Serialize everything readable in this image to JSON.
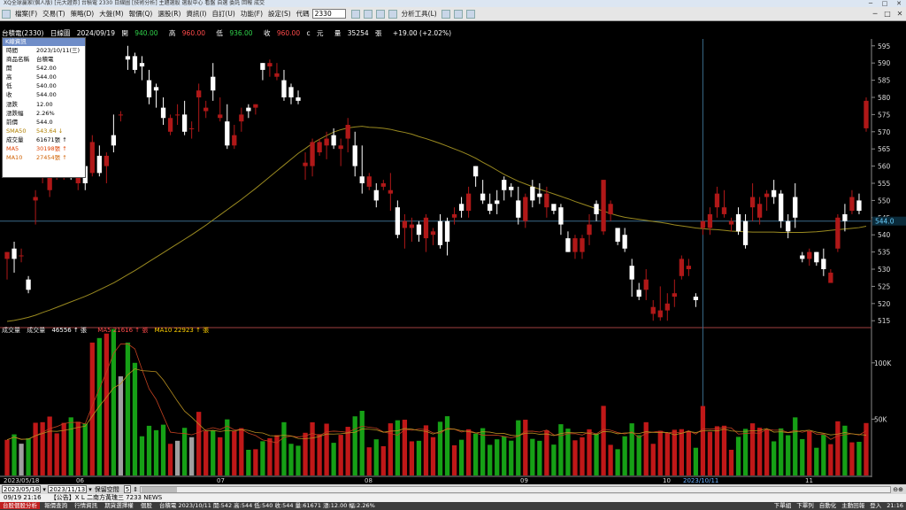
{
  "window": {
    "title": "XQ全球贏家(個人版) [元大證券] 台積電 2330 日線圖 [技術分析] 主題選股 選股中心 看盤 自選 委託 回報 成交",
    "controls": [
      "─",
      "□",
      "✕"
    ]
  },
  "menu": {
    "items": [
      "檔案(F)",
      "交易(T)",
      "策略(D)",
      "大盤(M)",
      "報價(Q)",
      "選股(R)",
      "資訊(I)",
      "自訂(U)",
      "功能(F)",
      "設定(S)",
      "代碼"
    ],
    "code_value": "2330",
    "tools_label": "分析工具(L)"
  },
  "stock": {
    "name": "台積電(2330)",
    "period": "日線圖",
    "date": "2024/09/19",
    "open_label": "開",
    "open": "940.00",
    "high_label": "高",
    "high": "960.00",
    "low_label": "低",
    "low": "936.00",
    "close_label": "收",
    "close": "960.00",
    "close_flag": "c",
    "unit": "元",
    "vol_label": "量",
    "volume": "35254",
    "vol_unit": "張",
    "change": "+19.00 (+2.02%)"
  },
  "tooltip": {
    "title": "K線資訊",
    "rows": [
      {
        "k": "時間",
        "v": "2023/10/11(三)",
        "c": "#000"
      },
      {
        "k": "商品名稱",
        "v": "台積電",
        "c": "#000"
      },
      {
        "k": "開",
        "v": "542.00",
        "c": "#000"
      },
      {
        "k": "高",
        "v": "544.00",
        "c": "#000"
      },
      {
        "k": "低",
        "v": "540.00",
        "c": "#000"
      },
      {
        "k": "收",
        "v": "544.00",
        "c": "#000"
      },
      {
        "k": "漲跌",
        "v": "12.00",
        "c": "#000"
      },
      {
        "k": "漲跌幅",
        "v": "2.26%",
        "c": "#000"
      },
      {
        "k": "前價",
        "v": "544.0",
        "c": "#000"
      },
      {
        "k": "SMA50",
        "v": "543.64 ↓",
        "c": "#b08000"
      },
      {
        "k": "成交量",
        "v": "61671張 ↑",
        "c": "#000"
      },
      {
        "k": "MA5",
        "v": "30198張 ↑",
        "c": "#e04000"
      },
      {
        "k": "MA10",
        "v": "27454張 ↑",
        "c": "#d06000"
      }
    ]
  },
  "volume_header": {
    "label": "成交量",
    "vol_name": "成交量",
    "vol": "46556 ↑ 張",
    "ma5": "MA5 21616 ↑ 張",
    "ma10": "MA10 22923 ↑ 張"
  },
  "price_axis": {
    "labels": [
      "595",
      "590",
      "585",
      "580",
      "575",
      "570",
      "565",
      "560",
      "555",
      "550",
      "545",
      "540",
      "535",
      "530",
      "525",
      "520",
      "515"
    ],
    "marker": "544.0"
  },
  "volume_axis": {
    "labels": [
      "100K",
      "50K"
    ]
  },
  "x_axis": {
    "labels": [
      "2023/05/18",
      "06",
      "07",
      "08",
      "09",
      "10",
      "2023/10/11",
      "11"
    ]
  },
  "date_range": {
    "from": "2023/05/18",
    "to": "2023/11/13",
    "keep_label": "保留空間",
    "keep_value": "5"
  },
  "status1": {
    "time": "09/19 21:16",
    "news": "【公告】X L 二南方黃瑰三 7233 NEWS"
  },
  "status2": {
    "items": [
      "台股個股分析",
      "報價查詢",
      "行情資訊",
      "期貨選擇權",
      "個股",
      "台積電 2023/10/11 開:542 高:544 低:540 收:544 量:61671 漲:12.00 幅:2.26%"
    ],
    "right": [
      "下單組",
      "下單列",
      "自動化",
      "主動回報",
      "登入",
      "21:16"
    ]
  },
  "colors": {
    "up": "#b01818",
    "down": "#ffffff",
    "up_vol": "#c01818",
    "down_vol": "#16a016",
    "flat_vol": "#a0a0a0",
    "sma50": "#9a8a20",
    "ma_vol": "#b89020",
    "accent": "#6f8dc8"
  },
  "chart_data": {
    "type": "candlestick",
    "title": "台積電(2330) 日線圖",
    "ylim": [
      513,
      597
    ],
    "vol_ylim": [
      0,
      125000
    ],
    "candles": [
      {
        "d": "05/18",
        "o": 533,
        "h": 535,
        "l": 527,
        "c": 535
      },
      {
        "d": "05/19",
        "o": 536,
        "h": 538,
        "l": 529,
        "c": 533
      },
      {
        "d": "05/22",
        "o": 534,
        "h": 536,
        "l": 532,
        "c": 534
      },
      {
        "d": "05/23",
        "o": 527,
        "h": 528,
        "l": 523,
        "c": 524
      },
      {
        "d": "05/24",
        "o": 550,
        "h": 553,
        "l": 543,
        "c": 551
      },
      {
        "d": "05/25",
        "o": 557,
        "h": 564,
        "l": 555,
        "c": 562
      },
      {
        "d": "05/26",
        "o": 553,
        "h": 568,
        "l": 551,
        "c": 566
      },
      {
        "d": "05/29",
        "o": 560,
        "h": 565,
        "l": 556,
        "c": 563
      },
      {
        "d": "05/30",
        "o": 561,
        "h": 568,
        "l": 556,
        "c": 566
      },
      {
        "d": "05/31",
        "o": 560,
        "h": 569,
        "l": 556,
        "c": 559
      },
      {
        "d": "06/01",
        "o": 555,
        "h": 563,
        "l": 553,
        "c": 559
      },
      {
        "d": "06/02",
        "o": 560,
        "h": 561,
        "l": 553,
        "c": 555
      },
      {
        "d": "06/05",
        "o": 558,
        "h": 569,
        "l": 557,
        "c": 567
      },
      {
        "d": "06/06",
        "o": 563,
        "h": 566,
        "l": 557,
        "c": 558
      },
      {
        "d": "06/07",
        "o": 560,
        "h": 564,
        "l": 555,
        "c": 563
      },
      {
        "d": "06/08",
        "o": 569,
        "h": 575,
        "l": 564,
        "c": 566
      },
      {
        "d": "06/09",
        "o": 575,
        "h": 576,
        "l": 573,
        "c": 575
      },
      {
        "d": "06/12",
        "o": 592,
        "h": 595,
        "l": 588,
        "c": 591
      },
      {
        "d": "06/13",
        "o": 592,
        "h": 593,
        "l": 587,
        "c": 588
      },
      {
        "d": "06/14",
        "o": 590,
        "h": 592,
        "l": 585,
        "c": 589
      },
      {
        "d": "06/15",
        "o": 585,
        "h": 588,
        "l": 578,
        "c": 580
      },
      {
        "d": "06/16",
        "o": 583,
        "h": 584,
        "l": 577,
        "c": 582
      },
      {
        "d": "06/19",
        "o": 577,
        "h": 580,
        "l": 572,
        "c": 574
      },
      {
        "d": "06/20",
        "o": 570,
        "h": 575,
        "l": 569,
        "c": 574
      },
      {
        "d": "06/21",
        "o": 575,
        "h": 578,
        "l": 572,
        "c": 575
      },
      {
        "d": "06/26",
        "o": 575,
        "h": 579,
        "l": 569,
        "c": 570
      },
      {
        "d": "06/27",
        "o": 571,
        "h": 573,
        "l": 568,
        "c": 571
      },
      {
        "d": "06/28",
        "o": 580,
        "h": 584,
        "l": 570,
        "c": 582
      },
      {
        "d": "06/29",
        "o": 576,
        "h": 579,
        "l": 574,
        "c": 577
      },
      {
        "d": "06/30",
        "o": 586,
        "h": 590,
        "l": 579,
        "c": 582
      },
      {
        "d": "07/03",
        "o": 574,
        "h": 580,
        "l": 573,
        "c": 575
      },
      {
        "d": "07/04",
        "o": 573,
        "h": 578,
        "l": 565,
        "c": 566
      },
      {
        "d": "07/05",
        "o": 566,
        "h": 572,
        "l": 565,
        "c": 569
      },
      {
        "d": "07/06",
        "o": 573,
        "h": 577,
        "l": 570,
        "c": 575
      },
      {
        "d": "07/07",
        "o": 577,
        "h": 578,
        "l": 574,
        "c": 576
      },
      {
        "d": "07/10",
        "o": 577,
        "h": 578,
        "l": 575,
        "c": 578
      },
      {
        "d": "07/11",
        "o": 590,
        "h": 590,
        "l": 585,
        "c": 588
      },
      {
        "d": "07/12",
        "o": 589,
        "h": 591,
        "l": 586,
        "c": 590
      },
      {
        "d": "07/13",
        "o": 586,
        "h": 590,
        "l": 585,
        "c": 587
      },
      {
        "d": "07/14",
        "o": 585,
        "h": 588,
        "l": 579,
        "c": 580
      },
      {
        "d": "07/17",
        "o": 583,
        "h": 584,
        "l": 578,
        "c": 580
      },
      {
        "d": "07/18",
        "o": 580,
        "h": 582,
        "l": 578,
        "c": 579
      },
      {
        "d": "07/19",
        "o": 560,
        "h": 564,
        "l": 556,
        "c": 561
      },
      {
        "d": "07/20",
        "o": 560,
        "h": 568,
        "l": 557,
        "c": 567
      },
      {
        "d": "07/21",
        "o": 564,
        "h": 568,
        "l": 563,
        "c": 567
      },
      {
        "d": "07/24",
        "o": 566,
        "h": 570,
        "l": 562,
        "c": 568
      },
      {
        "d": "07/25",
        "o": 569,
        "h": 571,
        "l": 565,
        "c": 566
      },
      {
        "d": "07/26",
        "o": 565,
        "h": 568,
        "l": 560,
        "c": 566
      },
      {
        "d": "07/27",
        "o": 568,
        "h": 574,
        "l": 564,
        "c": 572
      },
      {
        "d": "07/31",
        "o": 566,
        "h": 570,
        "l": 557,
        "c": 560
      },
      {
        "d": "08/01",
        "o": 557,
        "h": 566,
        "l": 552,
        "c": 555
      },
      {
        "d": "08/02",
        "o": 554,
        "h": 558,
        "l": 553,
        "c": 557
      },
      {
        "d": "08/03",
        "o": 553,
        "h": 555,
        "l": 548,
        "c": 550
      },
      {
        "d": "08/04",
        "o": 554,
        "h": 556,
        "l": 553,
        "c": 555
      },
      {
        "d": "08/07",
        "o": 552,
        "h": 558,
        "l": 547,
        "c": 553
      },
      {
        "d": "08/08",
        "o": 548,
        "h": 550,
        "l": 539,
        "c": 540
      },
      {
        "d": "08/09",
        "o": 542,
        "h": 546,
        "l": 536,
        "c": 544
      },
      {
        "d": "08/10",
        "o": 542,
        "h": 545,
        "l": 538,
        "c": 543
      },
      {
        "d": "08/11",
        "o": 543,
        "h": 544,
        "l": 538,
        "c": 540
      },
      {
        "d": "08/14",
        "o": 539,
        "h": 546,
        "l": 535,
        "c": 545
      },
      {
        "d": "08/15",
        "o": 540,
        "h": 542,
        "l": 537,
        "c": 541
      },
      {
        "d": "08/16",
        "o": 544,
        "h": 546,
        "l": 536,
        "c": 537
      },
      {
        "d": "08/17",
        "o": 544,
        "h": 545,
        "l": 534,
        "c": 538
      },
      {
        "d": "08/18",
        "o": 545,
        "h": 548,
        "l": 543,
        "c": 546
      },
      {
        "d": "08/21",
        "o": 549,
        "h": 551,
        "l": 545,
        "c": 547
      },
      {
        "d": "08/22",
        "o": 547,
        "h": 554,
        "l": 545,
        "c": 552
      },
      {
        "d": "08/23",
        "o": 560,
        "h": 560,
        "l": 554,
        "c": 557
      },
      {
        "d": "08/24",
        "o": 552,
        "h": 556,
        "l": 549,
        "c": 550
      },
      {
        "d": "08/25",
        "o": 549,
        "h": 552,
        "l": 546,
        "c": 547
      },
      {
        "d": "08/28",
        "o": 550,
        "h": 553,
        "l": 546,
        "c": 549
      },
      {
        "d": "08/29",
        "o": 556,
        "h": 557,
        "l": 550,
        "c": 553
      },
      {
        "d": "08/30",
        "o": 554,
        "h": 555,
        "l": 551,
        "c": 553
      },
      {
        "d": "08/31",
        "o": 550,
        "h": 554,
        "l": 543,
        "c": 545
      },
      {
        "d": "09/01",
        "o": 544,
        "h": 552,
        "l": 542,
        "c": 551
      },
      {
        "d": "09/04",
        "o": 554,
        "h": 556,
        "l": 548,
        "c": 550
      },
      {
        "d": "09/05",
        "o": 552,
        "h": 555,
        "l": 549,
        "c": 551
      },
      {
        "d": "09/06",
        "o": 548,
        "h": 554,
        "l": 545,
        "c": 552
      },
      {
        "d": "09/07",
        "o": 549,
        "h": 548,
        "l": 546,
        "c": 547
      },
      {
        "d": "09/08",
        "o": 548,
        "h": 549,
        "l": 540,
        "c": 543
      },
      {
        "d": "09/11",
        "o": 539,
        "h": 541,
        "l": 535,
        "c": 535
      },
      {
        "d": "09/12",
        "o": 535,
        "h": 540,
        "l": 533,
        "c": 539
      },
      {
        "d": "09/13",
        "o": 535,
        "h": 540,
        "l": 533,
        "c": 539
      },
      {
        "d": "09/14",
        "o": 540,
        "h": 546,
        "l": 537,
        "c": 543
      },
      {
        "d": "09/15",
        "o": 549,
        "h": 550,
        "l": 544,
        "c": 546
      },
      {
        "d": "09/18",
        "o": 541,
        "h": 556,
        "l": 540,
        "c": 556
      },
      {
        "d": "09/19",
        "o": 546,
        "h": 550,
        "l": 544,
        "c": 549
      },
      {
        "d": "09/20",
        "o": 542,
        "h": 540,
        "l": 537,
        "c": 538
      },
      {
        "d": "09/21",
        "o": 540,
        "h": 542,
        "l": 535,
        "c": 536
      },
      {
        "d": "09/22",
        "o": 531,
        "h": 533,
        "l": 522,
        "c": 527
      },
      {
        "d": "09/25",
        "o": 524,
        "h": 526,
        "l": 521,
        "c": 522
      },
      {
        "d": "09/26",
        "o": 524,
        "h": 530,
        "l": 521,
        "c": 527
      },
      {
        "d": "09/27",
        "o": 517,
        "h": 521,
        "l": 515,
        "c": 519
      },
      {
        "d": "09/28",
        "o": 516,
        "h": 525,
        "l": 515,
        "c": 518
      },
      {
        "d": "10/02",
        "o": 518,
        "h": 523,
        "l": 515,
        "c": 520
      },
      {
        "d": "10/03",
        "o": 522,
        "h": 527,
        "l": 519,
        "c": 523
      },
      {
        "d": "10/04",
        "o": 528,
        "h": 534,
        "l": 527,
        "c": 533
      },
      {
        "d": "10/05",
        "o": 530,
        "h": 533,
        "l": 528,
        "c": 531
      },
      {
        "d": "10/06",
        "o": 522,
        "h": 523,
        "l": 519,
        "c": 521
      },
      {
        "d": "10/11",
        "o": 542,
        "h": 544,
        "l": 540,
        "c": 544
      },
      {
        "d": "10/12",
        "o": 542,
        "h": 548,
        "l": 540,
        "c": 546
      },
      {
        "d": "10/13",
        "o": 548,
        "h": 554,
        "l": 545,
        "c": 552
      },
      {
        "d": "10/16",
        "o": 546,
        "h": 553,
        "l": 545,
        "c": 548
      },
      {
        "d": "10/17",
        "o": 543,
        "h": 545,
        "l": 541,
        "c": 544
      },
      {
        "d": "10/18",
        "o": 546,
        "h": 548,
        "l": 540,
        "c": 541
      },
      {
        "d": "10/19",
        "o": 544,
        "h": 546,
        "l": 536,
        "c": 537
      },
      {
        "d": "10/20",
        "o": 548,
        "h": 555,
        "l": 544,
        "c": 551
      },
      {
        "d": "10/23",
        "o": 545,
        "h": 551,
        "l": 543,
        "c": 549
      },
      {
        "d": "10/24",
        "o": 551,
        "h": 553,
        "l": 547,
        "c": 552
      },
      {
        "d": "10/25",
        "o": 553,
        "h": 556,
        "l": 549,
        "c": 551
      },
      {
        "d": "10/26",
        "o": 552,
        "h": 553,
        "l": 542,
        "c": 544
      },
      {
        "d": "10/27",
        "o": 544,
        "h": 546,
        "l": 539,
        "c": 541
      },
      {
        "d": "10/30",
        "o": 551,
        "h": 555,
        "l": 542,
        "c": 545
      },
      {
        "d": "10/31",
        "o": 534,
        "h": 535,
        "l": 532,
        "c": 533
      },
      {
        "d": "11/01",
        "o": 533,
        "h": 536,
        "l": 531,
        "c": 535
      },
      {
        "d": "11/02",
        "o": 535,
        "h": 535,
        "l": 531,
        "c": 532
      },
      {
        "d": "11/03",
        "o": 533,
        "h": 536,
        "l": 528,
        "c": 530
      },
      {
        "d": "11/06",
        "o": 526,
        "h": 530,
        "l": 527,
        "c": 529
      },
      {
        "d": "11/07",
        "o": 536,
        "h": 546,
        "l": 535,
        "c": 545
      },
      {
        "d": "11/08",
        "o": 546,
        "h": 549,
        "l": 541,
        "c": 544
      },
      {
        "d": "11/09",
        "o": 547,
        "h": 553,
        "l": 546,
        "c": 551
      },
      {
        "d": "11/10",
        "o": 550,
        "h": 552,
        "l": 546,
        "c": 547
      },
      {
        "d": "11/13",
        "o": 571,
        "h": 580,
        "l": 570,
        "c": 579
      }
    ],
    "sma50": [
      514.8,
      515.1,
      515.5,
      516,
      516.6,
      517.4,
      518.1,
      518.9,
      519.7,
      520.5,
      521.3,
      522.1,
      523,
      524,
      525,
      526,
      527.2,
      528.4,
      529.6,
      530.9,
      532.2,
      533.5,
      534.8,
      536.1,
      537.4,
      538.7,
      540,
      541.4,
      542.8,
      544.3,
      545.8,
      547.3,
      548.8,
      550.3,
      551.9,
      553.5,
      555.2,
      556.9,
      558.6,
      560.3,
      562,
      563.7,
      565.1,
      566.6,
      567.8,
      568.9,
      569.9,
      570.6,
      571.1,
      571.4,
      571.6,
      571.3,
      571.2,
      571,
      570.7,
      570.2,
      569.8,
      569.3,
      568.6,
      568,
      567.3,
      566.6,
      565.8,
      565,
      564.2,
      563.3,
      562.3,
      561.1,
      560,
      558.8,
      557.6,
      556.6,
      555.6,
      554.8,
      554,
      553.3,
      552.6,
      551.9,
      551.2,
      550.5,
      549.7,
      549,
      548.3,
      547.6,
      546.9,
      546.2,
      545.6,
      545.1,
      544.8,
      544.5,
      544.2,
      543.9,
      543.64,
      543.3,
      542.9,
      542.6,
      542.3,
      542,
      541.8,
      541.6,
      541.5,
      541.3,
      541.1,
      541,
      540.9,
      540.8,
      540.8,
      540.8,
      540.8,
      540.7,
      540.7,
      540.7,
      540.7,
      540.8,
      540.9,
      541.1,
      541.3,
      541.5,
      541.7,
      541.9,
      542.1,
      542.5
    ]
  }
}
